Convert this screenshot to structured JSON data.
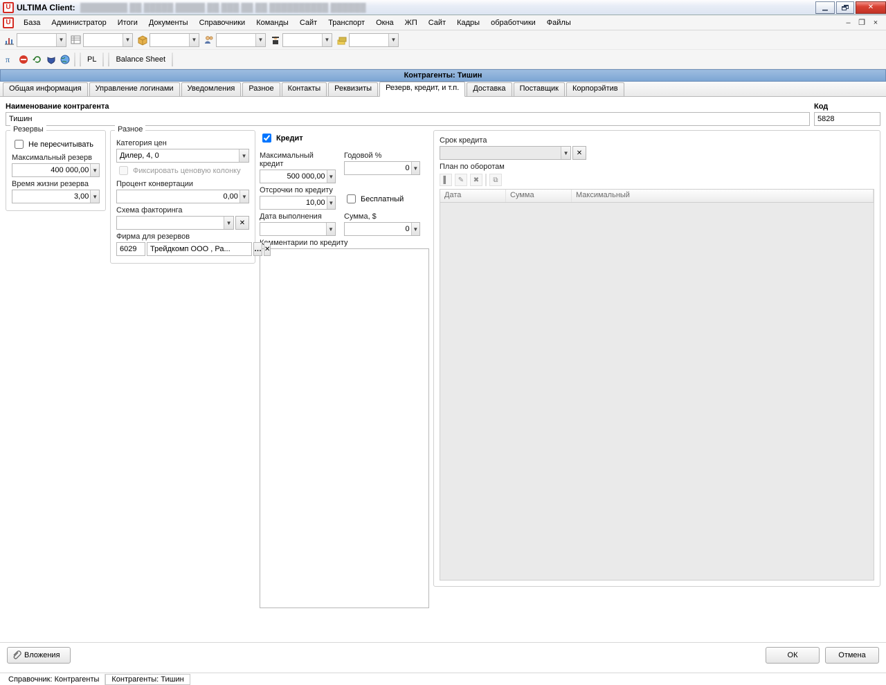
{
  "window": {
    "app_title": "ULTIMA Client:",
    "minimize": "_",
    "close": "X"
  },
  "menu": {
    "items": [
      "База",
      "Администратор",
      "Итоги",
      "Документы",
      "Справочники",
      "Команды",
      "Сайт",
      "Транспорт",
      "Окна",
      "ЖП",
      "Сайт",
      "Кадры",
      "обработчики",
      "Файлы"
    ]
  },
  "toolbar2": {
    "pl": "PL",
    "bs": "Balance Sheet"
  },
  "doc_title": "Контрагенты: Тишин",
  "tabs": [
    "Общая информация",
    "Управление логинами",
    "Уведомления",
    "Разное",
    "Контакты",
    "Реквизиты",
    "Резерв, кредит, и т.п.",
    "Доставка",
    "Поставщик",
    "Корпорэйтив"
  ],
  "active_tab_index": 6,
  "name": {
    "label": "Наименование контрагента",
    "value": "Тишин"
  },
  "code": {
    "label": "Код",
    "value": "5828"
  },
  "reserves": {
    "legend": "Резервы",
    "dont_recalc": "Не пересчитывать",
    "max_label": "Максимальный резерв",
    "max_value": "400 000,00",
    "life_label": "Время жизни резерва",
    "life_value": "3,00"
  },
  "misc": {
    "legend": "Разное",
    "pricecat_label": "Категория цен",
    "pricecat_value": "Дилер, 4, 0",
    "fix_col": "Фиксировать ценовую колонку",
    "conv_label": "Процент конвертации",
    "conv_value": "0,00",
    "scheme_label": "Схема факторинга",
    "firm_label": "Фирма для резервов",
    "firm_code": "6029",
    "firm_name": "Трейдкомп ООО , Ра..."
  },
  "credit": {
    "legend": "Кредит",
    "max_label": "Максимальный кредит",
    "max_value": "500 000,00",
    "year_label": "Годовой %",
    "year_value": "0",
    "defer_label": "Отсрочки по кредиту",
    "defer_value": "10,00",
    "free_label": "Бесплатный",
    "exec_label": "Дата выполнения",
    "sum_label": "Сумма, $",
    "sum_value": "0",
    "comments_label": "Комментарии по кредиту"
  },
  "right": {
    "term_label": "Срок кредита",
    "plan_label": "План по оборотам",
    "col_date": "Дата",
    "col_sum": "Сумма",
    "col_max": "Максимальный"
  },
  "bottom": {
    "attachments": "Вложения",
    "ok": "ОК",
    "cancel": "Отмена"
  },
  "status": {
    "a": "Справочник: Контрагенты",
    "b": "Контрагенты: Тишин"
  }
}
